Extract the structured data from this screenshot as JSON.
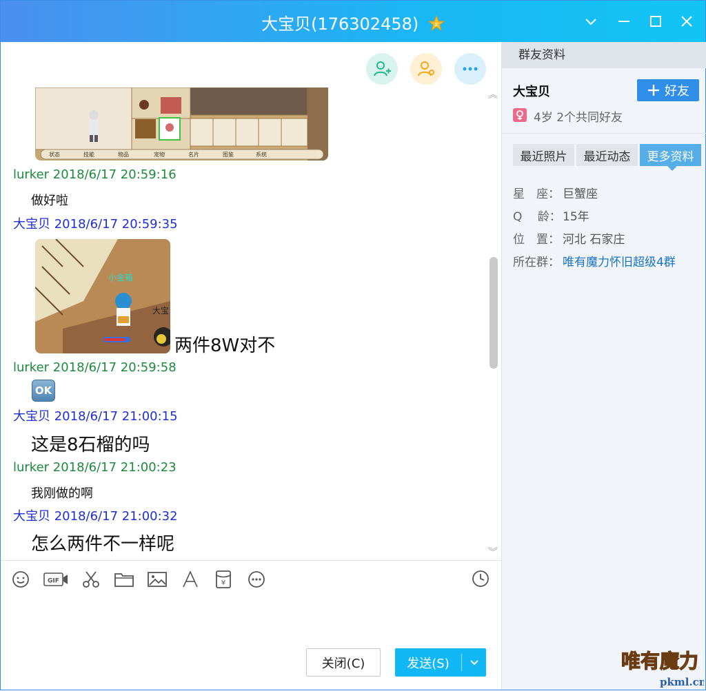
{
  "window": {
    "title": "大宝贝(176302458)"
  },
  "chat": {
    "messages": [
      {
        "sender": "lurker",
        "time": "2018/6/17 20:59:16",
        "header": "lurker 2018/6/17 20:59:16",
        "text": "做好啦",
        "color": "#1d8a3c"
      },
      {
        "sender": "大宝贝",
        "time": "2018/6/17 20:59:35",
        "header": "大宝贝 2018/6/17 20:59:35",
        "text": "两件8W对不",
        "color": "#1e2fd6"
      },
      {
        "sender": "lurker",
        "time": "2018/6/17 20:59:58",
        "header": "lurker 2018/6/17 20:59:58",
        "text": "OK",
        "color": "#1d8a3c"
      },
      {
        "sender": "大宝贝",
        "time": "2018/6/17 21:00:15",
        "header": "大宝贝 2018/6/17 21:00:15",
        "text": "这是8石榴的吗",
        "color": "#1e2fd6"
      },
      {
        "sender": "lurker",
        "time": "2018/6/17 21:00:23",
        "header": "lurker 2018/6/17 21:00:23",
        "text": "我刚做的啊",
        "color": "#1d8a3c"
      },
      {
        "sender": "大宝贝",
        "time": "2018/6/17 21:00:32",
        "header": "大宝贝 2018/6/17 21:00:32",
        "text": "怎么两件不一样呢",
        "color": "#1e2fd6"
      }
    ],
    "game_ui_tabs": [
      "状态",
      "技能",
      "物品",
      "宠物",
      "名片",
      "图鉴",
      "系统"
    ],
    "game_label": "小金箱",
    "game_label2": "大宝"
  },
  "toolbar": {
    "icons": [
      "smiley-icon",
      "gif-icon",
      "scissors-icon",
      "folder-icon",
      "image-icon",
      "font-icon",
      "red-packet-icon",
      "more-icon"
    ],
    "gif_label": "GIF"
  },
  "buttons": {
    "close_label": "关闭(C)",
    "send_label": "发送(S)"
  },
  "profile": {
    "header": "群友资料",
    "name": "大宝贝",
    "add_friend": "好友",
    "summary": "4岁 2个共同好友",
    "tabs": [
      "最近照片",
      "最近动态",
      "更多资料"
    ],
    "active_tab": "更多资料",
    "info": [
      {
        "key": "星　座：",
        "value": "巨蟹座"
      },
      {
        "key": "Q　 龄：",
        "value": "15年"
      },
      {
        "key": "位　置：",
        "value": "河北 石家庄"
      },
      {
        "key": "所在群：",
        "value": "唯有魔力怀旧超级4群"
      }
    ]
  },
  "watermark": {
    "text": "唯有魔力",
    "site": "pkml.cn"
  },
  "colors": {
    "accent": "#12b7f5",
    "lurker": "#1d8a3c",
    "other": "#1e2fd6"
  }
}
